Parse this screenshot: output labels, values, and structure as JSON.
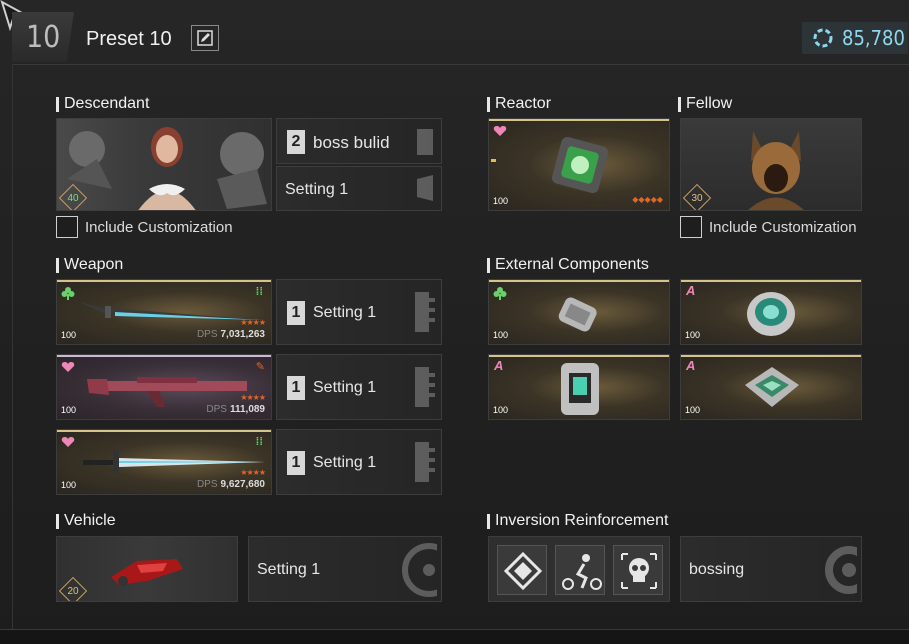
{
  "header": {
    "preset_number": "10",
    "preset_name": "Preset 10",
    "currency_value": "85,780"
  },
  "descendant": {
    "label": "Descendant",
    "level": "40",
    "build_index": "2",
    "build_name": "boss bulid",
    "setting": "Setting 1",
    "include_customization": "Include Customization"
  },
  "reactor": {
    "label": "Reactor",
    "level": "100",
    "enhancement_marks": "◆◆◆◆◆"
  },
  "fellow": {
    "label": "Fellow",
    "level": "30",
    "include_customization": "Include Customization"
  },
  "weapon": {
    "label": "Weapon",
    "items": [
      {
        "level": "100",
        "dps_label": "DPS",
        "dps": "7,031,263",
        "stars": "★★★★",
        "tier": "club",
        "setting_index": "1",
        "setting": "Setting 1"
      },
      {
        "level": "100",
        "dps_label": "DPS",
        "dps": "111,089",
        "stars": "★★★★",
        "tier": "heart",
        "setting_index": "1",
        "setting": "Setting 1"
      },
      {
        "level": "100",
        "dps_label": "DPS",
        "dps": "9,627,680",
        "stars": "★★★★",
        "tier": "heart",
        "setting_index": "1",
        "setting": "Setting 1"
      }
    ]
  },
  "external_components": {
    "label": "External Components",
    "items": [
      {
        "level": "100",
        "tier": "club"
      },
      {
        "level": "100",
        "tier": "A"
      },
      {
        "level": "100",
        "tier": "A"
      },
      {
        "level": "100",
        "tier": "A"
      }
    ]
  },
  "vehicle": {
    "label": "Vehicle",
    "level": "20",
    "setting": "Setting 1"
  },
  "inversion": {
    "label": "Inversion Reinforcement",
    "name": "bossing"
  },
  "colors": {
    "accent_cyan": "#8fd7ee",
    "gold": "#d6c38a",
    "orange": "#e0652a",
    "green": "#5fd65f"
  }
}
